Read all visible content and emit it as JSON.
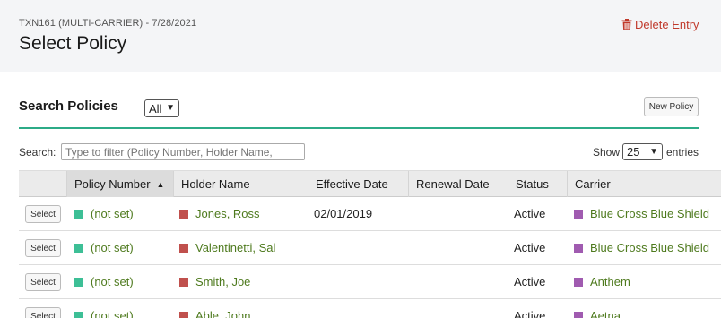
{
  "header": {
    "subtitle": "TXN161 (MULTI-CARRIER) - 7/28/2021",
    "title": "Select Policy",
    "delete_label": "Delete Entry"
  },
  "search_section": {
    "title": "Search Policies",
    "filter_value": "All",
    "new_policy_label": "New Policy",
    "search_label": "Search:",
    "search_placeholder": "Type to filter (Policy Number, Holder Name,",
    "show_label": "Show",
    "entries_value": "25",
    "entries_label": "entries"
  },
  "table": {
    "columns": [
      "",
      "Policy Number",
      "Holder Name",
      "Effective Date",
      "Renewal Date",
      "Status",
      "Carrier"
    ],
    "select_label": "Select",
    "rows": [
      {
        "policy": "(not set)",
        "holder": "Jones, Ross",
        "effective": "02/01/2019",
        "renewal": "",
        "status": "Active",
        "carrier": "Blue Cross Blue Shield"
      },
      {
        "policy": "(not set)",
        "holder": "Valentinetti, Sal",
        "effective": "",
        "renewal": "",
        "status": "Active",
        "carrier": "Blue Cross Blue Shield"
      },
      {
        "policy": "(not set)",
        "holder": "Smith, Joe",
        "effective": "",
        "renewal": "",
        "status": "Active",
        "carrier": "Anthem"
      },
      {
        "policy": "(not set)",
        "holder": "Able, John",
        "effective": "",
        "renewal": "",
        "status": "Active",
        "carrier": "Aetna"
      }
    ]
  },
  "colors": {
    "accent": "#2cab87",
    "policy_marker": "#3dbf96",
    "holder_marker": "#c0504d",
    "carrier_marker": "#a05bb0",
    "link_text": "#4e7a1e",
    "delete": "#c0392b"
  },
  "icons": {
    "delete": "trash-icon",
    "sort": "sort-ascending-icon",
    "dropdown": "chevron-down-icon"
  }
}
